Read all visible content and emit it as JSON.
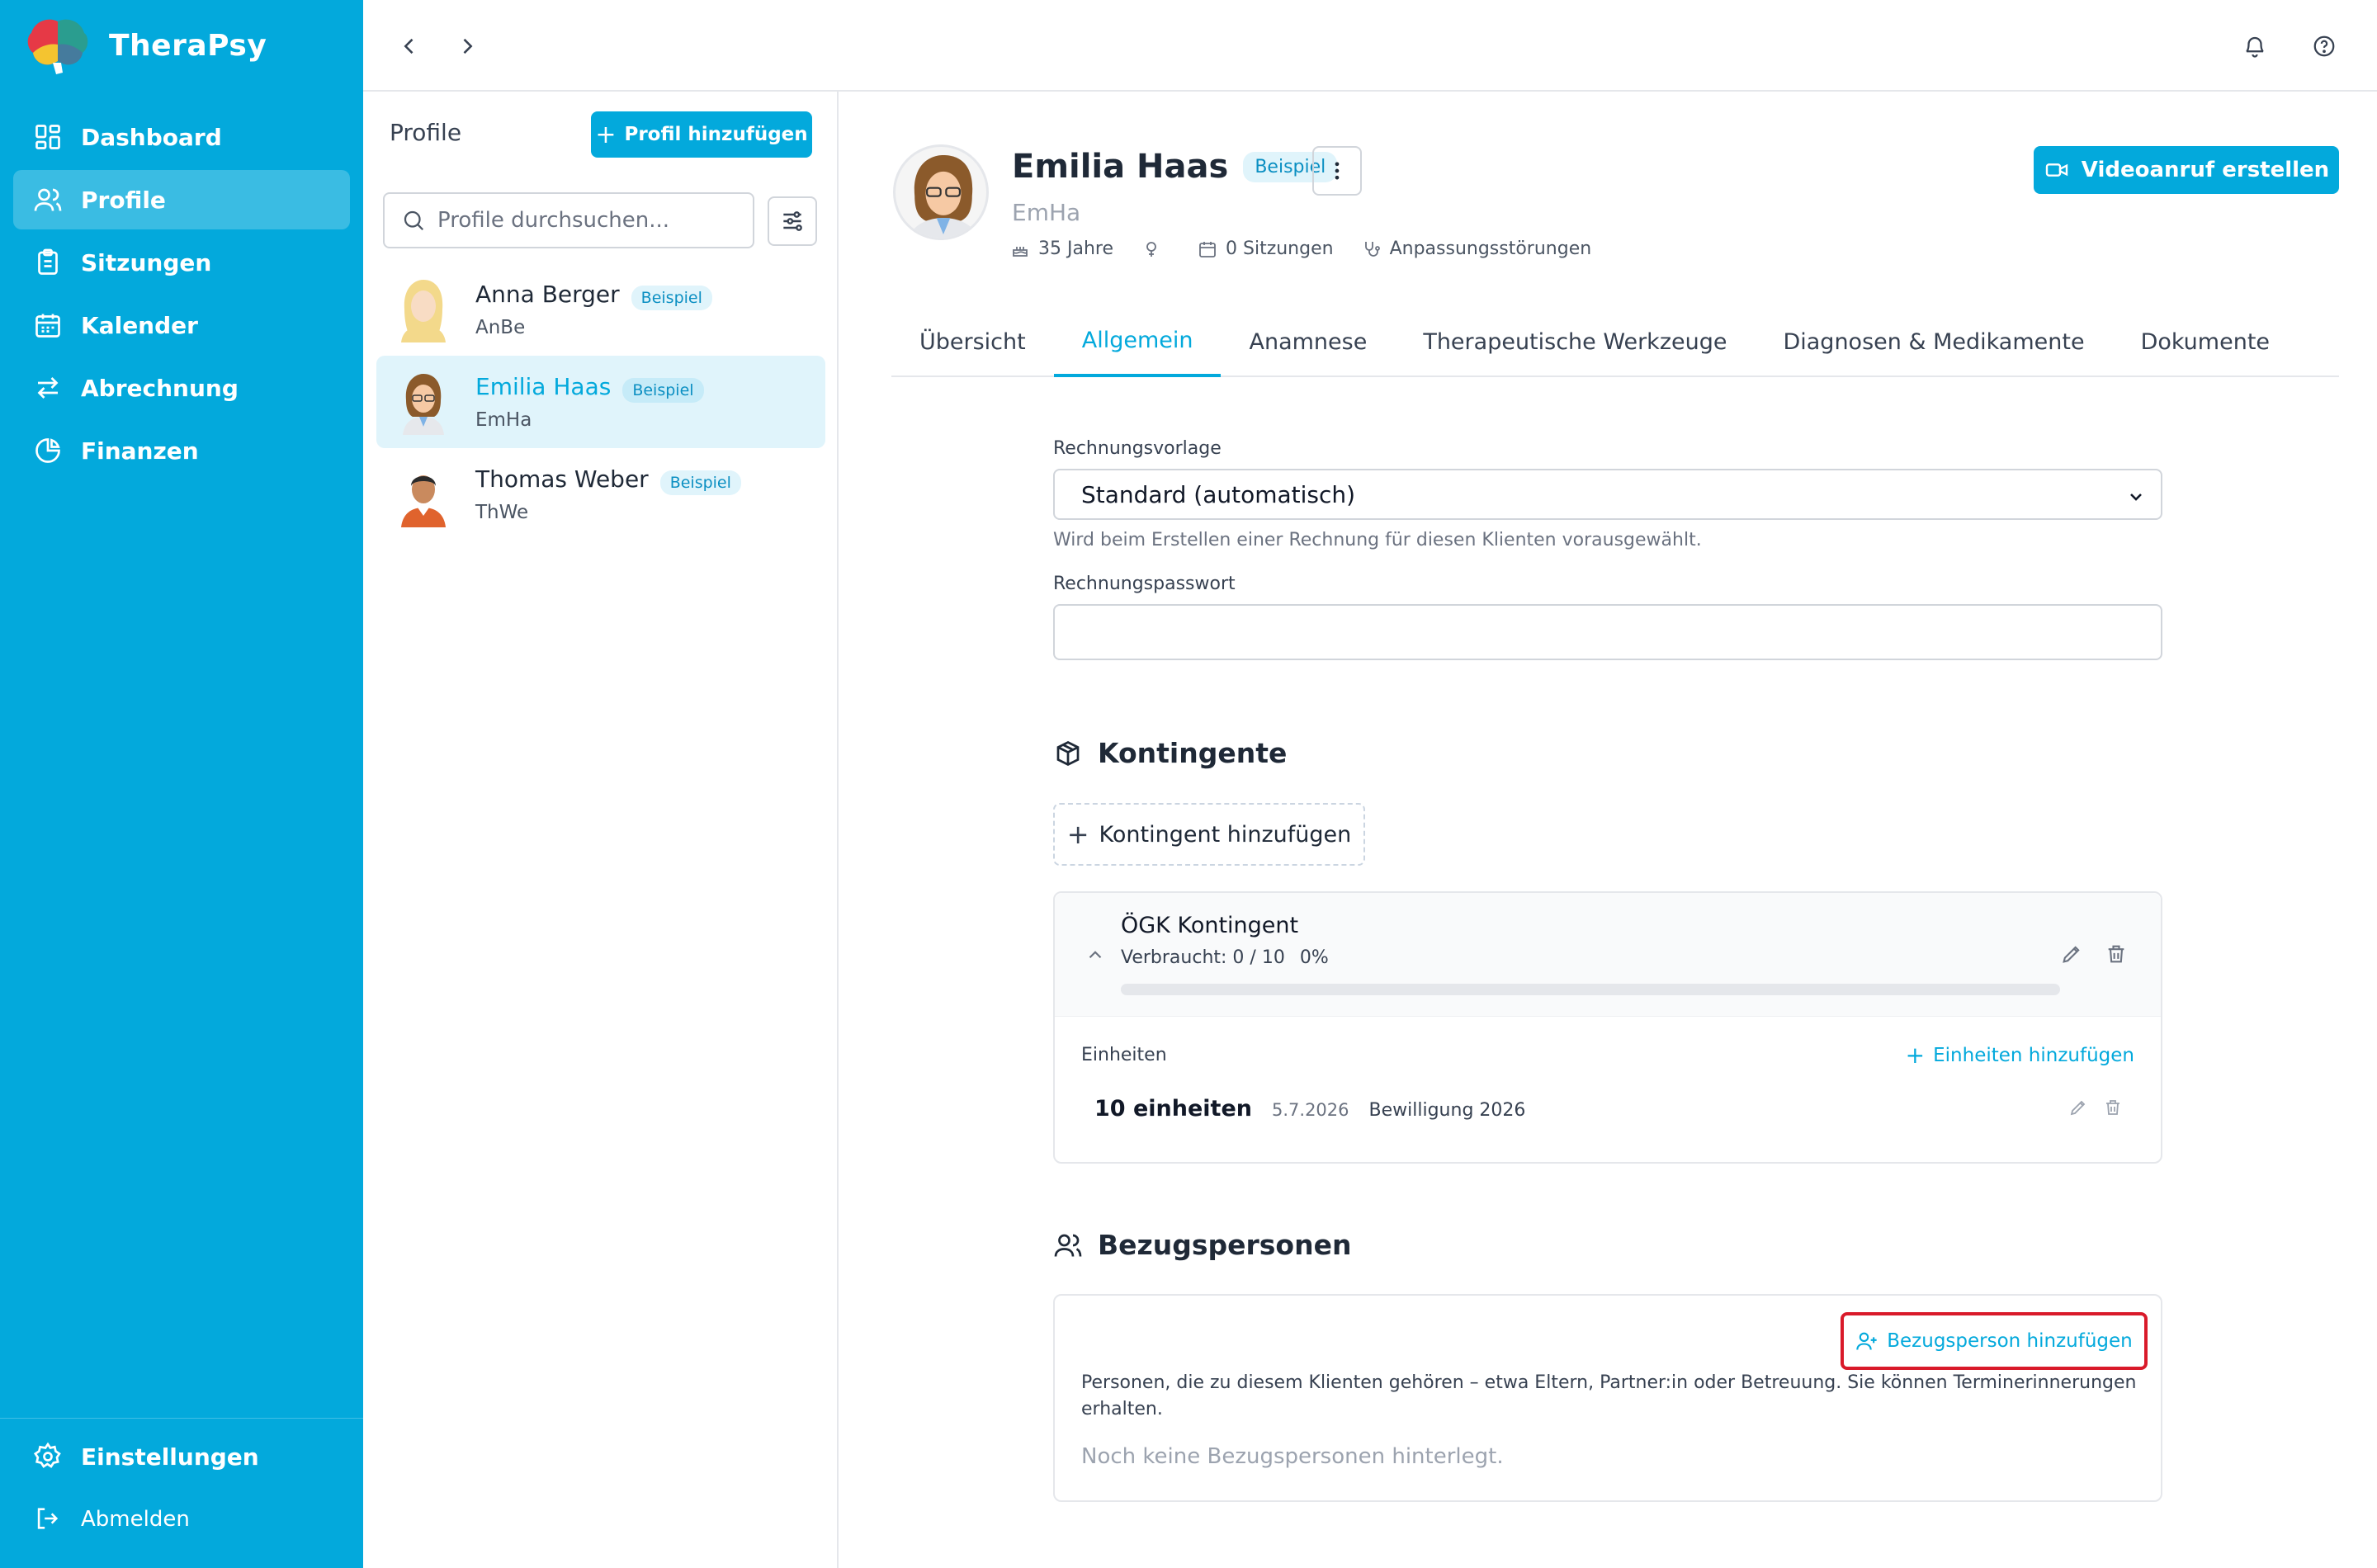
{
  "app": {
    "name": "TheraPsy",
    "accent_color": "#03a9dc"
  },
  "sidebar": {
    "items": [
      {
        "label": "Dashboard",
        "icon": "dashboard-icon"
      },
      {
        "label": "Profile",
        "icon": "users-icon",
        "active": true
      },
      {
        "label": "Sitzungen",
        "icon": "clipboard-icon"
      },
      {
        "label": "Kalender",
        "icon": "calendar-icon"
      },
      {
        "label": "Abrechnung",
        "icon": "arrows-exchange-icon"
      },
      {
        "label": "Finanzen",
        "icon": "pie-chart-icon"
      }
    ],
    "bottom": [
      {
        "label": "Einstellungen",
        "icon": "gear-icon"
      },
      {
        "label": "Abmelden",
        "icon": "logout-icon"
      }
    ]
  },
  "topbar": {
    "back_icon": "chevron-left-icon",
    "forward_icon": "chevron-right-icon",
    "notifications_icon": "bell-icon",
    "help_icon": "help-circle-icon"
  },
  "profiles_panel": {
    "title": "Profile",
    "add_button": "Profil hinzufügen",
    "search_placeholder": "Profile durchsuchen...",
    "items": [
      {
        "name": "Anna Berger",
        "initials": "AnBe",
        "badge": "Beispiel"
      },
      {
        "name": "Emilia Haas",
        "initials": "EmHa",
        "badge": "Beispiel",
        "active": true
      },
      {
        "name": "Thomas Weber",
        "initials": "ThWe",
        "badge": "Beispiel"
      }
    ]
  },
  "client": {
    "name": "Emilia Haas",
    "badge": "Beispiel",
    "initials": "EmHa",
    "age": "35 Jahre",
    "sessions": "0 Sitzungen",
    "diagnosis": "Anpassungsstörungen",
    "video_button": "Videoanruf erstellen"
  },
  "tabs": [
    "Übersicht",
    "Allgemein",
    "Anamnese",
    "Therapeutische Werkzeuge",
    "Diagnosen & Medikamente",
    "Dokumente"
  ],
  "active_tab": "Allgemein",
  "billing": {
    "template_label": "Rechnungsvorlage",
    "template_value": "Standard (automatisch)",
    "template_help": "Wird beim Erstellen einer Rechnung für diesen Klienten vorausgewählt.",
    "password_label": "Rechnungspasswort",
    "password_value": ""
  },
  "kontingente": {
    "title": "Kontingente",
    "add_button": "Kontingent hinzufügen",
    "items": [
      {
        "name": "ÖGK Kontingent",
        "used_text": "Verbraucht: 0 / 10",
        "percent_text": "0%",
        "used_fraction": 0,
        "units_label": "Einheiten",
        "units_add": "Einheiten hinzufügen",
        "units": [
          {
            "count": "10 einheiten",
            "date": "5.7.2026",
            "note": "Bewilligung 2026"
          }
        ]
      }
    ]
  },
  "bezugspersonen": {
    "title": "Bezugspersonen",
    "add_button": "Bezugsperson hinzufügen",
    "description": "Personen, die zu diesem Klienten gehören – etwa Eltern, Partner:in oder Betreuung. Sie können Terminerinnerungen erhalten.",
    "empty": "Noch keine Bezugspersonen hinterlegt."
  }
}
